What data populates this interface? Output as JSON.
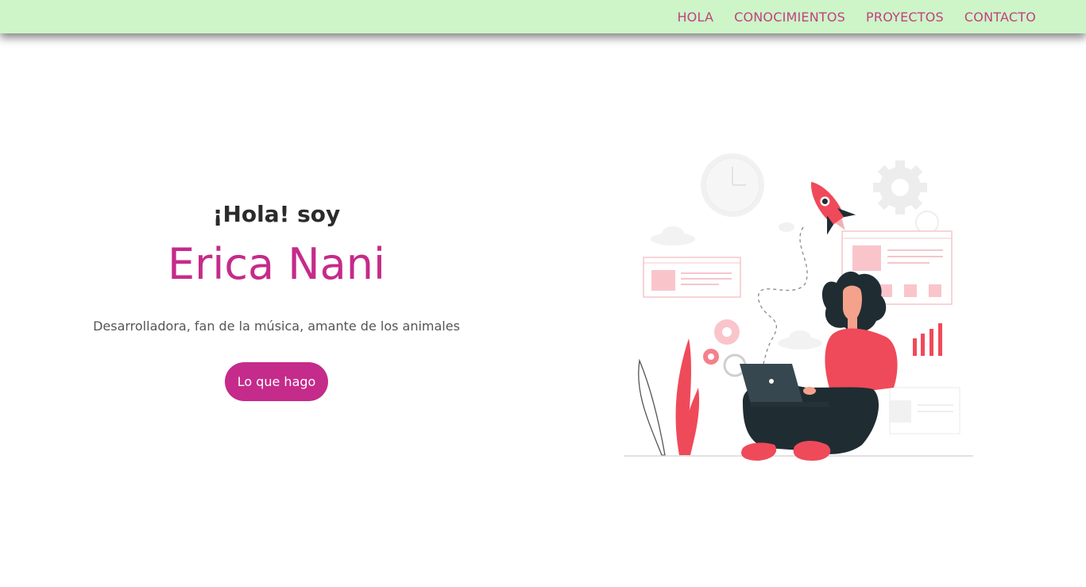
{
  "nav": {
    "items": [
      {
        "label": "HOLA"
      },
      {
        "label": "CONOCIMIENTOS"
      },
      {
        "label": "PROYECTOS"
      },
      {
        "label": "CONTACTO"
      }
    ]
  },
  "hero": {
    "greeting": "¡Hola! soy",
    "name": "Erica Nani",
    "tagline": "Desarrolladora, fan de la música, amante de los animales",
    "cta_label": "Lo que hago"
  },
  "colors": {
    "navbar_bg": "#cdf5c8",
    "nav_text": "#c2417f",
    "accent": "#c52b8a",
    "illustration_red": "#ef4a5a",
    "illustration_dark": "#1f2d33"
  },
  "illustration": {
    "icon": "woman-with-laptop-illustration"
  }
}
